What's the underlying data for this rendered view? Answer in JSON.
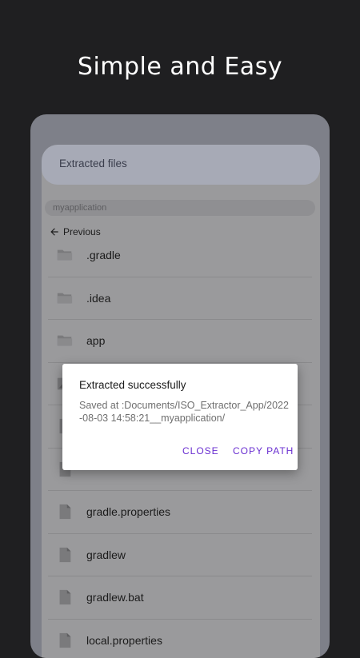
{
  "promo": {
    "title": "Simple and Easy"
  },
  "appbar": {
    "title": "Extracted files"
  },
  "path": {
    "current": "myapplication"
  },
  "nav": {
    "previous_label": "Previous"
  },
  "files": [
    {
      "name": ".gradle",
      "type": "folder"
    },
    {
      "name": ".idea",
      "type": "folder"
    },
    {
      "name": "app",
      "type": "folder"
    },
    {
      "name": "",
      "type": "image"
    },
    {
      "name": "",
      "type": "file"
    },
    {
      "name": "",
      "type": "file"
    },
    {
      "name": "gradle.properties",
      "type": "file"
    },
    {
      "name": "gradlew",
      "type": "file"
    },
    {
      "name": "gradlew.bat",
      "type": "file"
    },
    {
      "name": "local.properties",
      "type": "file"
    }
  ],
  "dialog": {
    "title": "Extracted successfully",
    "message": "Saved at :Documents/ISO_Extractor_App/2022-08-03 14:58:21__myapplication/",
    "close_label": "CLOSE",
    "copy_label": "COPY PATH"
  },
  "colors": {
    "background": "#1f1f21",
    "accent": "#6a2fd1",
    "icon_gray": "#7a7a7c"
  }
}
